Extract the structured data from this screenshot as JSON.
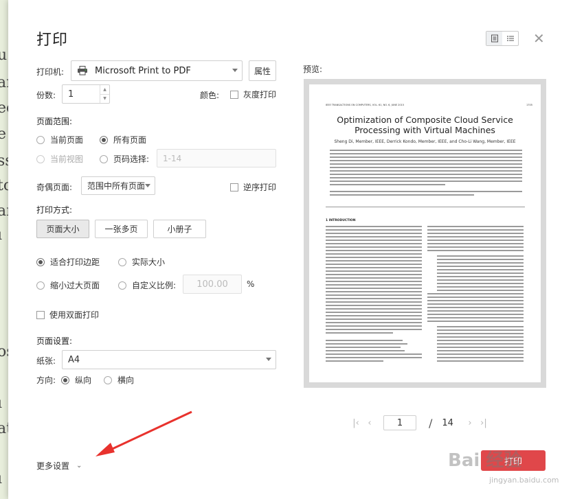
{
  "background_doc": {
    "letters": [
      "u",
      "ar",
      "ec",
      "e",
      "ss",
      "to",
      "aı",
      "ı",
      "os",
      "ı",
      "at",
      "ı"
    ]
  },
  "dialog": {
    "title": "打印",
    "printer": {
      "label": "打印机:",
      "value": "Microsoft Print to PDF",
      "properties_button": "属性"
    },
    "copies": {
      "label": "份数:",
      "value": "1"
    },
    "color": {
      "label": "颜色:",
      "grayscale": "灰度打印"
    },
    "page_range": {
      "section_title": "页面范围:",
      "current_page": "当前页面",
      "all_pages": "所有页面",
      "current_view": "当前视图",
      "page_select": "页码选择:",
      "page_select_placeholder": "1-14"
    },
    "odd_even": {
      "label": "奇偶页面:",
      "value": "范围中所有页面",
      "reverse": "逆序打印"
    },
    "print_mode": {
      "section_title": "打印方式:",
      "buttons": [
        "页面大小",
        "一张多页",
        "小册子"
      ],
      "fit_margin": "适合打印边距",
      "actual_size": "实际大小",
      "shrink_oversize": "缩小过大页面",
      "custom_scale": "自定义比例:",
      "custom_scale_value": "100.00",
      "percent": "%"
    },
    "duplex": "使用双面打印",
    "page_setup": {
      "section_title": "页面设置:",
      "paper_label": "纸张:",
      "paper_value": "A4",
      "orientation_label": "方向:",
      "portrait": "纵向",
      "landscape": "横向"
    },
    "more_settings": "更多设置",
    "preview_label": "预览:",
    "pager": {
      "current": "1",
      "separator": "/",
      "total": "14"
    },
    "print_button": "打印"
  },
  "preview_page": {
    "header": "IEEE TRANSACTIONS ON COMPUTERS,  VOL. 61,  NO. 6,  JUNE 2015",
    "page_number": "1705",
    "title_line1": "Optimization of Composite Cloud Service",
    "title_line2": "Processing with Virtual Machines",
    "authors": "Sheng Di, Member, IEEE, Derrick Kondo, Member, IEEE, and Cho-Li Wang, Member, IEEE",
    "section": "1   INTRODUCTION"
  },
  "watermark": {
    "text": "Bai 经验",
    "url": "jingyan.baidu.com"
  },
  "colors": {
    "accent": "#e0474a",
    "border": "#cfcfcf",
    "preview_bg": "#d9d9d9"
  }
}
